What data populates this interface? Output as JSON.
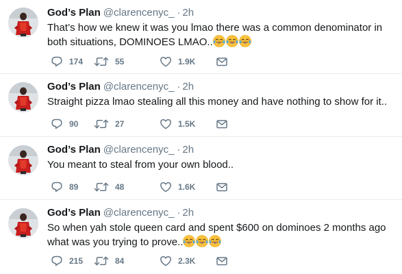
{
  "tweets": [
    {
      "name": "God’s Plan",
      "handle": "@clarencenyc_",
      "separator": "·",
      "time": "2h",
      "text": "That’s how we knew it was you lmao there was a common denominator in both situations, DOMINOES LMAO..",
      "emoji": [
        "face-with-tears-of-joy",
        "face-with-tears-of-joy",
        "face-with-tears-of-joy"
      ],
      "replies": "174",
      "retweets": "55",
      "likes": "1.9K"
    },
    {
      "name": "God’s Plan",
      "handle": "@clarencenyc_",
      "separator": "·",
      "time": "2h",
      "text": "Straight pizza lmao stealing all this money and have nothing to show for it..",
      "emoji": [],
      "replies": "90",
      "retweets": "27",
      "likes": "1.5K"
    },
    {
      "name": "God’s Plan",
      "handle": "@clarencenyc_",
      "separator": "·",
      "time": "2h",
      "text": "You meant to steal from your own blood..",
      "emoji": [],
      "replies": "89",
      "retweets": "48",
      "likes": "1.6K"
    },
    {
      "name": "God’s Plan",
      "handle": "@clarencenyc_",
      "separator": "·",
      "time": "2h",
      "text": "So when yah stole queen card and spent $600 on dominoes 2 months ago what was you trying to prove..",
      "emoji": [
        "face-with-tears-of-joy",
        "face-with-tears-of-joy",
        "face-with-tears-of-joy"
      ],
      "replies": "215",
      "retweets": "84",
      "likes": "2.3K"
    }
  ],
  "icons": {
    "reply": "reply-icon",
    "retweet": "retweet-icon",
    "like": "heart-icon",
    "dm": "envelope-icon"
  },
  "colors": {
    "text": "#14171a",
    "secondary": "#657786",
    "divider": "#e6ecf0"
  }
}
